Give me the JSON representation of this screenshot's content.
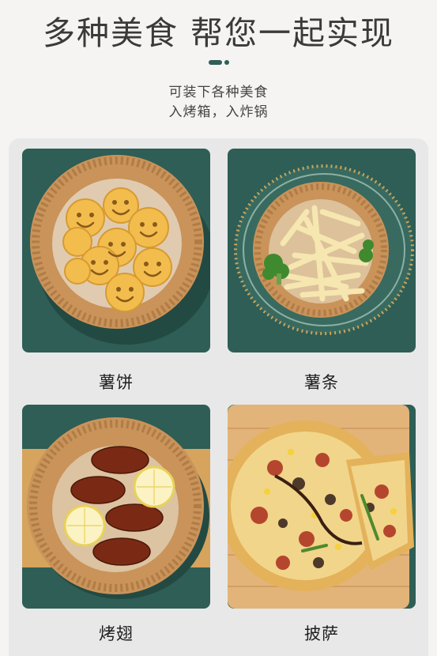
{
  "header": {
    "title": "多种美食 帮您一起实现",
    "subtitle_line1": "可装下各种美食",
    "subtitle_line2": "入烤箱，入炸锅"
  },
  "items": [
    {
      "label": "薯饼"
    },
    {
      "label": "薯条"
    },
    {
      "label": "烤翅"
    },
    {
      "label": "披萨"
    }
  ],
  "colors": {
    "background": "#f5f4f2",
    "panel": "#e8e8e8",
    "card_green": "#2e5e55",
    "paper_liner": "#c9935a",
    "accent": "#2f5f55"
  }
}
